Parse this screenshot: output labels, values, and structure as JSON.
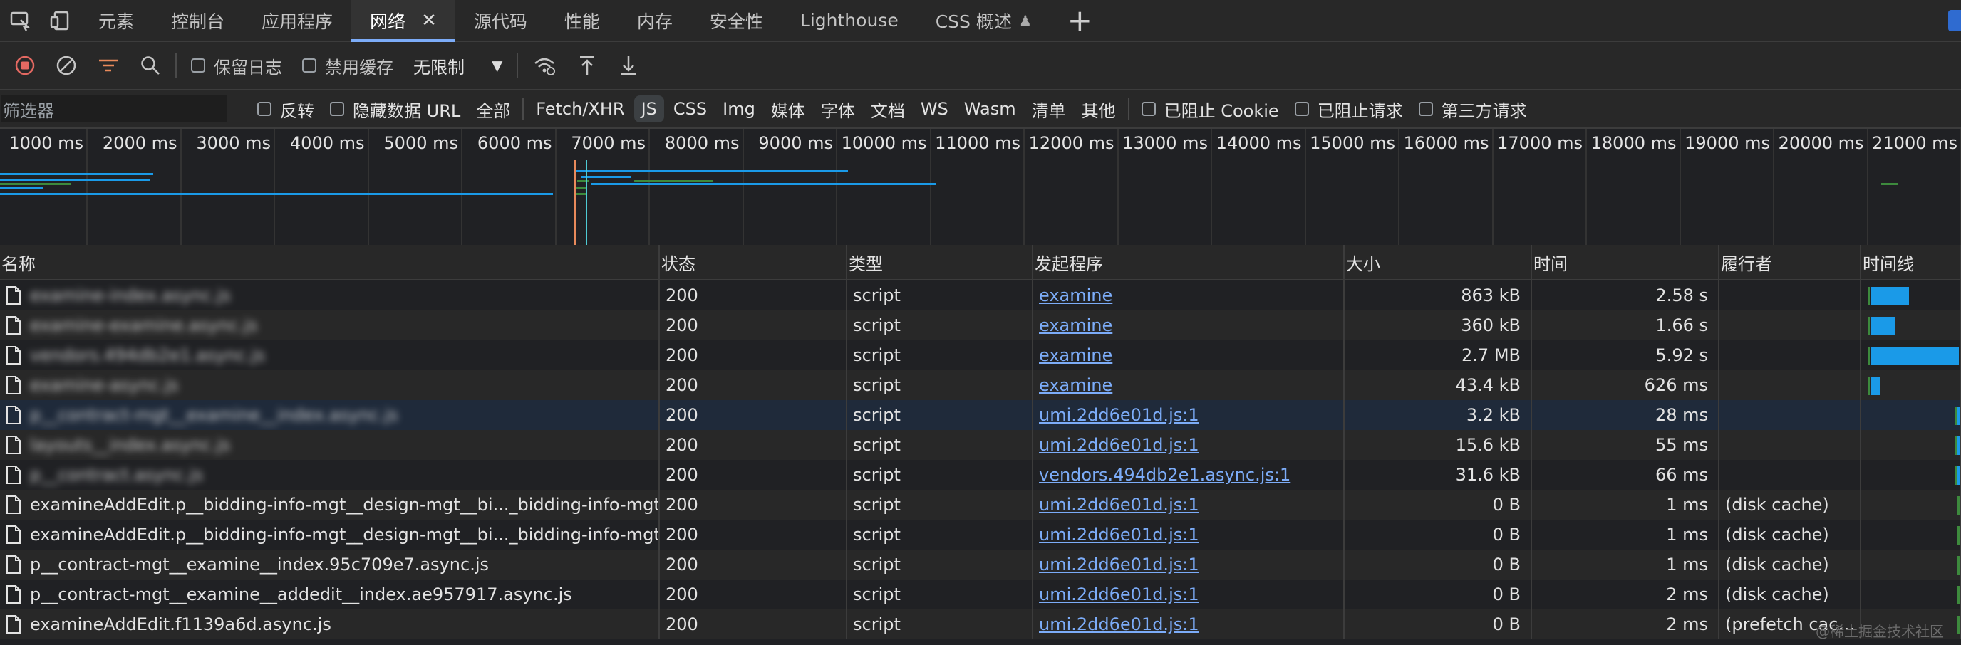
{
  "tabs": [
    {
      "label": "元素"
    },
    {
      "label": "控制台"
    },
    {
      "label": "应用程序"
    },
    {
      "label": "网络",
      "active": true
    },
    {
      "label": "源代码"
    },
    {
      "label": "性能"
    },
    {
      "label": "内存"
    },
    {
      "label": "安全性"
    },
    {
      "label": "Lighthouse"
    },
    {
      "label": "CSS 概述"
    }
  ],
  "toolbar": {
    "preserve_log": "保留日志",
    "disable_cache": "禁用缓存",
    "throttle": "无限制"
  },
  "filter": {
    "placeholder": "筛选器",
    "invert": "反转",
    "hide_data_urls": "隐藏数据 URL",
    "types": [
      "全部",
      "Fetch/XHR",
      "JS",
      "CSS",
      "Img",
      "媒体",
      "字体",
      "文档",
      "WS",
      "Wasm",
      "清单",
      "其他"
    ],
    "active_type": "JS",
    "blocked_cookies": "已阻止 Cookie",
    "blocked_requests": "已阻止请求",
    "third_party": "第三方请求"
  },
  "overview": {
    "ticks": [
      "1000 ms",
      "2000 ms",
      "3000 ms",
      "4000 ms",
      "5000 ms",
      "6000 ms",
      "7000 ms",
      "8000 ms",
      "9000 ms",
      "10000 ms",
      "11000 ms",
      "12000 ms",
      "13000 ms",
      "14000 ms",
      "15000 ms",
      "16000 ms",
      "17000 ms",
      "18000 ms",
      "19000 ms",
      "20000 ms",
      "21000 ms"
    ]
  },
  "columns": {
    "name": "名称",
    "status": "状态",
    "type": "类型",
    "initiator": "发起程序",
    "size": "大小",
    "time": "时间",
    "fulfiller": "履行者",
    "waterfall": "时间线"
  },
  "rows": [
    {
      "name": "examine-index.async.js",
      "blurred": true,
      "status": "200",
      "type": "script",
      "initiator": "examine",
      "size": "863 kB",
      "time": "2.58 s",
      "fulfiller": "",
      "wf_start": 0.02,
      "wf_width": 0.42
    },
    {
      "name": "examine-examine.async.js",
      "blurred": true,
      "status": "200",
      "type": "script",
      "initiator": "examine",
      "size": "360 kB",
      "time": "1.66 s",
      "fulfiller": "",
      "wf_start": 0.02,
      "wf_width": 0.27
    },
    {
      "name": "vendors.494db2e1.async.js",
      "blurred": true,
      "status": "200",
      "type": "script",
      "initiator": "examine",
      "size": "2.7 MB",
      "time": "5.92 s",
      "fulfiller": "",
      "wf_start": 0.02,
      "wf_width": 0.96
    },
    {
      "name": "examine-async.js",
      "blurred": true,
      "status": "200",
      "type": "script",
      "initiator": "examine",
      "size": "43.4 kB",
      "time": "626 ms",
      "fulfiller": "",
      "wf_start": 0.02,
      "wf_width": 0.1
    },
    {
      "name": "p__contract-mgt__examine__index.async.js",
      "blurred": true,
      "status": "200",
      "type": "script",
      "initiator": "umi.2dd6e01d.js:1",
      "size": "3.2 kB",
      "time": "28 ms",
      "fulfiller": "",
      "wf_start": 0.96,
      "wf_width": 0.02,
      "selected": true
    },
    {
      "name": "layouts__index.async.js",
      "blurred": true,
      "status": "200",
      "type": "script",
      "initiator": "umi.2dd6e01d.js:1",
      "size": "15.6 kB",
      "time": "55 ms",
      "fulfiller": "",
      "wf_start": 0.96,
      "wf_width": 0.02
    },
    {
      "name": "p__contract.async.js",
      "blurred": true,
      "status": "200",
      "type": "script",
      "initiator": "vendors.494db2e1.async.js:1",
      "size": "31.6 kB",
      "time": "66 ms",
      "fulfiller": "",
      "wf_start": 0.96,
      "wf_width": 0.02
    },
    {
      "name": "examineAddEdit.p__bidding-info-mgt__design-mgt__bi..._bidding-info-mgt__d...",
      "status": "200",
      "type": "script",
      "initiator": "umi.2dd6e01d.js:1",
      "size": "0 B",
      "time": "1 ms",
      "fulfiller": "(disk cache)",
      "wf_start": 0.99,
      "wf_width": 0.01
    },
    {
      "name": "examineAddEdit.p__bidding-info-mgt__design-mgt__bi..._bidding-info-mgt__d...",
      "status": "200",
      "type": "script",
      "initiator": "umi.2dd6e01d.js:1",
      "size": "0 B",
      "time": "1 ms",
      "fulfiller": "(disk cache)",
      "wf_start": 0.99,
      "wf_width": 0.01
    },
    {
      "name": "p__contract-mgt__examine__index.95c709e7.async.js",
      "status": "200",
      "type": "script",
      "initiator": "umi.2dd6e01d.js:1",
      "size": "0 B",
      "time": "1 ms",
      "fulfiller": "(disk cache)",
      "wf_start": 0.99,
      "wf_width": 0.01
    },
    {
      "name": "p__contract-mgt__examine__addedit__index.ae957917.async.js",
      "status": "200",
      "type": "script",
      "initiator": "umi.2dd6e01d.js:1",
      "size": "0 B",
      "time": "2 ms",
      "fulfiller": "(disk cache)",
      "wf_start": 0.99,
      "wf_width": 0.01
    },
    {
      "name": "examineAddEdit.f1139a6d.async.js",
      "status": "200",
      "type": "script",
      "initiator": "umi.2dd6e01d.js:1",
      "size": "0 B",
      "time": "2 ms",
      "fulfiller": "(prefetch cache)",
      "wf_start": 0.99,
      "wf_width": 0.01
    }
  ],
  "watermark": "@稀土掘金技术社区",
  "colors": {
    "accent": "#7cacf8",
    "record": "#e46962",
    "waterfall": "#1a9ae8"
  }
}
